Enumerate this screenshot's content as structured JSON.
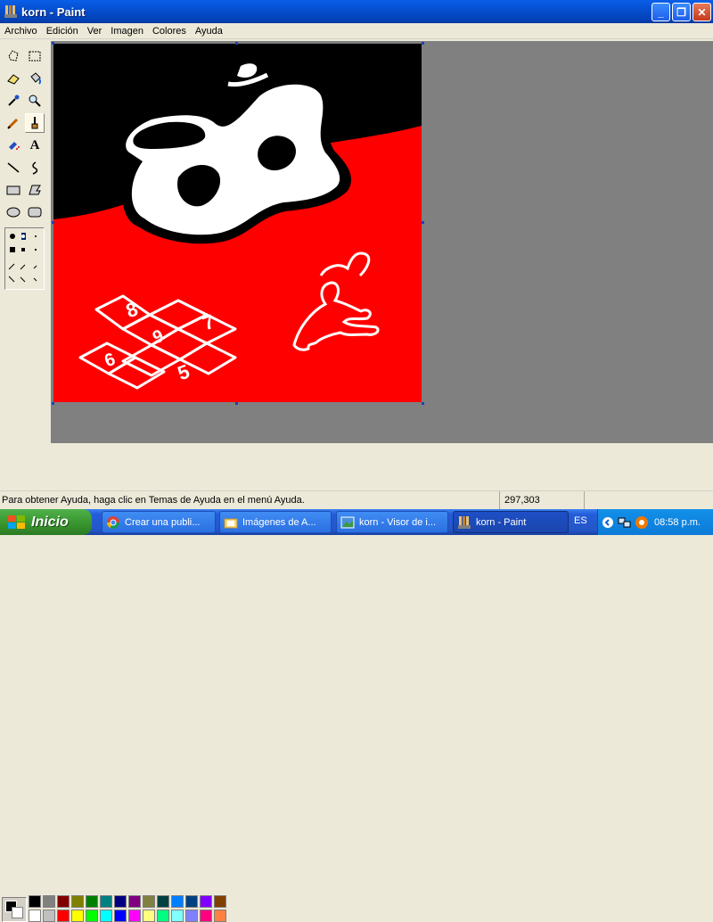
{
  "window": {
    "title": "korn - Paint"
  },
  "menu": [
    "Archivo",
    "Edición",
    "Ver",
    "Imagen",
    "Colores",
    "Ayuda"
  ],
  "tools": [
    "free-select",
    "rect-select",
    "eraser",
    "fill",
    "color-picker",
    "magnifier",
    "pencil",
    "brush",
    "airbrush",
    "text",
    "line",
    "curve",
    "rectangle",
    "polygon",
    "ellipse",
    "rounded-rectangle"
  ],
  "palette": {
    "row1": [
      "#000000",
      "#808080",
      "#800000",
      "#808000",
      "#008000",
      "#008080",
      "#000080",
      "#800080",
      "#808040",
      "#004040",
      "#0080ff",
      "#004080",
      "#8000ff",
      "#804000"
    ],
    "row2": [
      "#ffffff",
      "#c0c0c0",
      "#ff0000",
      "#ffff00",
      "#00ff00",
      "#00ffff",
      "#0000ff",
      "#ff00ff",
      "#ffff80",
      "#00ff80",
      "#80ffff",
      "#8080ff",
      "#ff0080",
      "#ff8040"
    ]
  },
  "status": {
    "message": "Para obtener Ayuda, haga clic en Temas de Ayuda en el menú Ayuda.",
    "coords": "297,303"
  },
  "taskbar": {
    "start": "Inicio",
    "tasks": [
      "Crear una publi...",
      "Imágenes de A...",
      "korn - Visor de i...",
      "korn - Paint"
    ],
    "lang": "ES",
    "clock": "08:58 p.m."
  },
  "canvas": {
    "hopscotch": [
      "8",
      "9",
      "7",
      "6",
      "5"
    ]
  }
}
